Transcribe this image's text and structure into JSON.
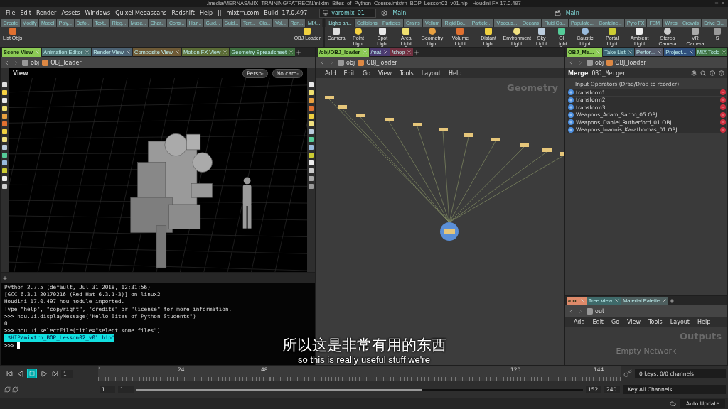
{
  "title_bar": {
    "path": "/media/MERNAS/MIX_TRAINING/PATREON/mixtrn_Bites_of_Python_Course/mixtrn_BOP_Lesson03_v01.hip - Houdini FX 17.0.497"
  },
  "menu_bar": {
    "items": [
      "File",
      "Edit",
      "Render",
      "Assets",
      "Windows",
      "Quixel Megascans",
      "Redshift",
      "Help"
    ],
    "separator": "||",
    "site": "mixtrn.com",
    "build": "Build: 17.0.497",
    "desktop": "varomix_01",
    "network_desktop": "Main",
    "playbar_desktop": "Main"
  },
  "left_shelf": {
    "tabs": [
      {
        "label": "Create",
        "selected": false
      },
      {
        "label": "Modify",
        "selected": false
      },
      {
        "label": "Model",
        "selected": false
      },
      {
        "label": "Poly...",
        "selected": false
      },
      {
        "label": "Defo...",
        "selected": false
      },
      {
        "label": "Text...",
        "selected": false
      },
      {
        "label": "Rigg...",
        "selected": false
      },
      {
        "label": "Musc...",
        "selected": false
      },
      {
        "label": "Char...",
        "selected": false
      },
      {
        "label": "Cons...",
        "selected": false
      },
      {
        "label": "Hair...",
        "selected": false
      },
      {
        "label": "Guid...",
        "selected": false
      },
      {
        "label": "Guid...",
        "selected": false
      },
      {
        "label": "Terr...",
        "selected": false
      },
      {
        "label": "Clo...",
        "selected": false
      },
      {
        "label": "Vol...",
        "selected": false
      },
      {
        "label": "Ren...",
        "selected": false
      },
      {
        "label": "MIX...",
        "selected": true
      }
    ],
    "tools": [
      "List Objs",
      "OBJ Loader"
    ]
  },
  "right_shelf": {
    "tabs": [
      {
        "label": "Lights an...",
        "selected": true
      },
      {
        "label": "Collisions",
        "selected": false
      },
      {
        "label": "Particles",
        "selected": false
      },
      {
        "label": "Grains",
        "selected": false
      },
      {
        "label": "Vellum",
        "selected": false
      },
      {
        "label": "Rigid Bo...",
        "selected": false
      },
      {
        "label": "Particle...",
        "selected": false
      },
      {
        "label": "Viscous...",
        "selected": false
      },
      {
        "label": "Oceans",
        "selected": false
      },
      {
        "label": "Fluid Co...",
        "selected": false
      },
      {
        "label": "Populate...",
        "selected": false
      },
      {
        "label": "Containe...",
        "selected": false
      },
      {
        "label": "Pyro FX",
        "selected": false
      },
      {
        "label": "FEM",
        "selected": false
      },
      {
        "label": "Wires",
        "selected": false
      },
      {
        "label": "Crowds",
        "selected": false
      },
      {
        "label": "Drive Si...",
        "selected": false
      }
    ],
    "tools": [
      "Camera",
      "Point Light",
      "Spot Light",
      "Area Light",
      "Geometry Light",
      "Volume Light",
      "Distant Light",
      "Environment Light",
      "Sky Light",
      "GI Light",
      "Caustic Light",
      "Portal Light",
      "Ambient Light",
      "Stereo Camera",
      "VR Camera",
      "S"
    ]
  },
  "viewport": {
    "tabs": [
      {
        "label": "Scene View",
        "selected": true,
        "color": "#8ccb55"
      },
      {
        "label": "Animation Editor",
        "selected": false,
        "color": "#4d7272"
      },
      {
        "label": "Render View",
        "selected": false,
        "color": "#4c6273"
      },
      {
        "label": "Composite View",
        "selected": false,
        "color": "#6e5a36"
      },
      {
        "label": "Motion FX View",
        "selected": false,
        "color": "#5b6c36"
      },
      {
        "label": "Geometry Spreadsheet",
        "selected": false,
        "color": "#3f6e3f"
      }
    ],
    "path": [
      "obj",
      "OBJ_loader"
    ],
    "title": "View",
    "camera_buttons": [
      "Persp-",
      "No cam-"
    ]
  },
  "python_shell": {
    "lines": [
      "Python 2.7.5 (default, Jul 31 2018, 12:31:56)",
      "[GCC 6.3.1 20170216 (Red Hat 6.3.1-3)] on linux2",
      "Houdini 17.0.497 hou module imported.",
      "Type \"help\", \"copyright\", \"credits\" or \"license\" for more information.",
      ">>> hou.ui.displayMessage(\"Hello Bites of Python Students\")",
      "0",
      ">>> hou.ui.selectFile(title=\"select some files\")"
    ],
    "selected_result": "'$HIP/mixtrn_BOP_Lesson02_v01.hip'",
    "prompt": ">>>"
  },
  "network": {
    "tabs": [
      {
        "label": "/obj/OBJ_loader",
        "selected": true,
        "color": "#8ccb55"
      },
      {
        "label": "/mat",
        "selected": false,
        "color": "#4a3a70"
      },
      {
        "label": "/shop",
        "selected": false,
        "color": "#703040"
      }
    ],
    "path": [
      "obj",
      "OBJ_loader"
    ],
    "menu": [
      "Add",
      "Edit",
      "Go",
      "View",
      "Tools",
      "Layout",
      "Help"
    ],
    "context": "Geometry"
  },
  "parameters": {
    "tabs": [
      {
        "label": "OBJ_Me...",
        "selected": true,
        "color": "#8ccb55"
      },
      {
        "label": "Take List",
        "selected": false,
        "color": "#3a6272"
      },
      {
        "label": "Perfor...",
        "selected": false,
        "color": "#555b6c"
      },
      {
        "label": "Project...",
        "selected": false,
        "color": "#2f4f7c"
      },
      {
        "label": "MIX Todo",
        "selected": false,
        "color": "#3f7242"
      }
    ],
    "path": [
      "obj",
      "OBJ_loader"
    ],
    "node_type": "Merge",
    "node_name": "OBJ_Merger",
    "heading": "Input Operators (Drag/Drop to reorder)",
    "inputs": [
      "transform1",
      "transform2",
      "transform3",
      "Weapons_Adam_Sacco_05.OBJ",
      "Weapons_Daniel_Rutherford_01.OBJ",
      "Weapons_Ioannis_Karathomas_01.OBJ"
    ]
  },
  "outputs": {
    "tabs": [
      {
        "label": "/out",
        "selected": true,
        "color": "#de8a6a"
      },
      {
        "label": "Tree View",
        "selected": false,
        "color": "#3f6a6a"
      },
      {
        "label": "Material Palette",
        "selected": false,
        "color": "#4e5e5e"
      }
    ],
    "path": [
      "out"
    ],
    "menu": [
      "Add",
      "Edit",
      "Go",
      "View",
      "Tools",
      "Layout",
      "Help"
    ],
    "context": "Outputs",
    "message": "Empty Network"
  },
  "timeline": {
    "frame": "1",
    "ruler_labels": [
      "1",
      "24",
      "48",
      "120",
      "144"
    ],
    "range_start": "1",
    "range_current": "1",
    "range_slider": {
      "level": 0.64
    },
    "range_end": "152",
    "range_total": "240",
    "keys_status": "0 keys, 0/0 channels",
    "key_all": "Key All Channels"
  },
  "status_bar": {
    "update_mode": "Auto Update"
  },
  "subtitles": {
    "chinese": "所以这是非常有用的东西",
    "english": "so this is really useful stuff we're"
  }
}
